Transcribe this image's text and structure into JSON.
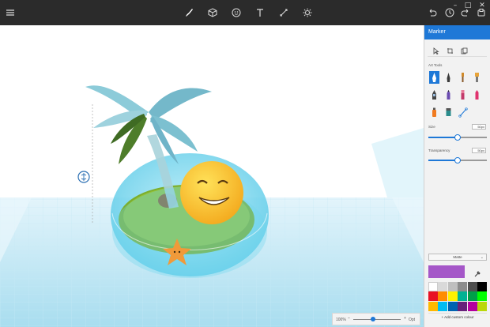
{
  "toolbar": {
    "left": [
      {
        "name": "menu"
      }
    ],
    "center": [
      {
        "name": "brushes",
        "active": true
      },
      {
        "name": "3d-objects"
      },
      {
        "name": "stickers"
      },
      {
        "name": "text"
      },
      {
        "name": "effects"
      },
      {
        "name": "canvas"
      }
    ],
    "right": [
      {
        "name": "undo"
      },
      {
        "name": "history"
      },
      {
        "name": "redo"
      },
      {
        "name": "paste"
      }
    ],
    "window_controls": [
      "–",
      "□",
      "✕"
    ]
  },
  "panel": {
    "title": "Marker",
    "art_tools_label": "Art Tools",
    "size": {
      "label": "Size",
      "value": "50px",
      "level": 0.5
    },
    "transparency": {
      "label": "Transparency",
      "value": "50px",
      "level": 0.5
    },
    "finish": "Matte",
    "current_color": "#a557c8",
    "add_color_label": "+  Add custom colour",
    "palette": [
      "#ffffff",
      "#d9d9d9",
      "#bfbfbf",
      "#8c8c8c",
      "#4d4d4d",
      "#000000",
      "#e81123",
      "#ff8c00",
      "#fff100",
      "#00b294",
      "#009e49",
      "#00ff00",
      "#ffb900",
      "#00bcf2",
      "#0063b1",
      "#68217a",
      "#b4009e",
      "#bad80a"
    ]
  },
  "zoom": {
    "left_label": "100%",
    "right_label": "Opt",
    "level": 0.4
  }
}
